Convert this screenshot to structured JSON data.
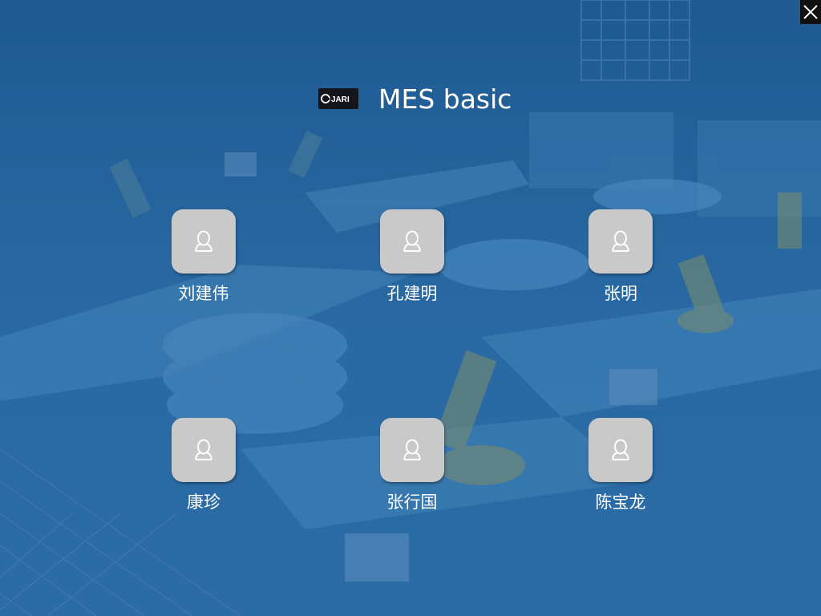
{
  "app": {
    "logo_text": "JARI",
    "title": "MES basic",
    "close_icon": "close-icon"
  },
  "users": [
    {
      "name": "刘建伟",
      "icon": "user-icon"
    },
    {
      "name": "孔建明",
      "icon": "user-icon"
    },
    {
      "name": "张明",
      "icon": "user-icon"
    },
    {
      "name": "康珍",
      "icon": "user-icon"
    },
    {
      "name": "张行国",
      "icon": "user-icon"
    },
    {
      "name": "陈宝龙",
      "icon": "user-icon"
    }
  ],
  "colors": {
    "background": "#225d95",
    "avatar_tile": "#c9c9c9",
    "close_button": "#111111"
  }
}
